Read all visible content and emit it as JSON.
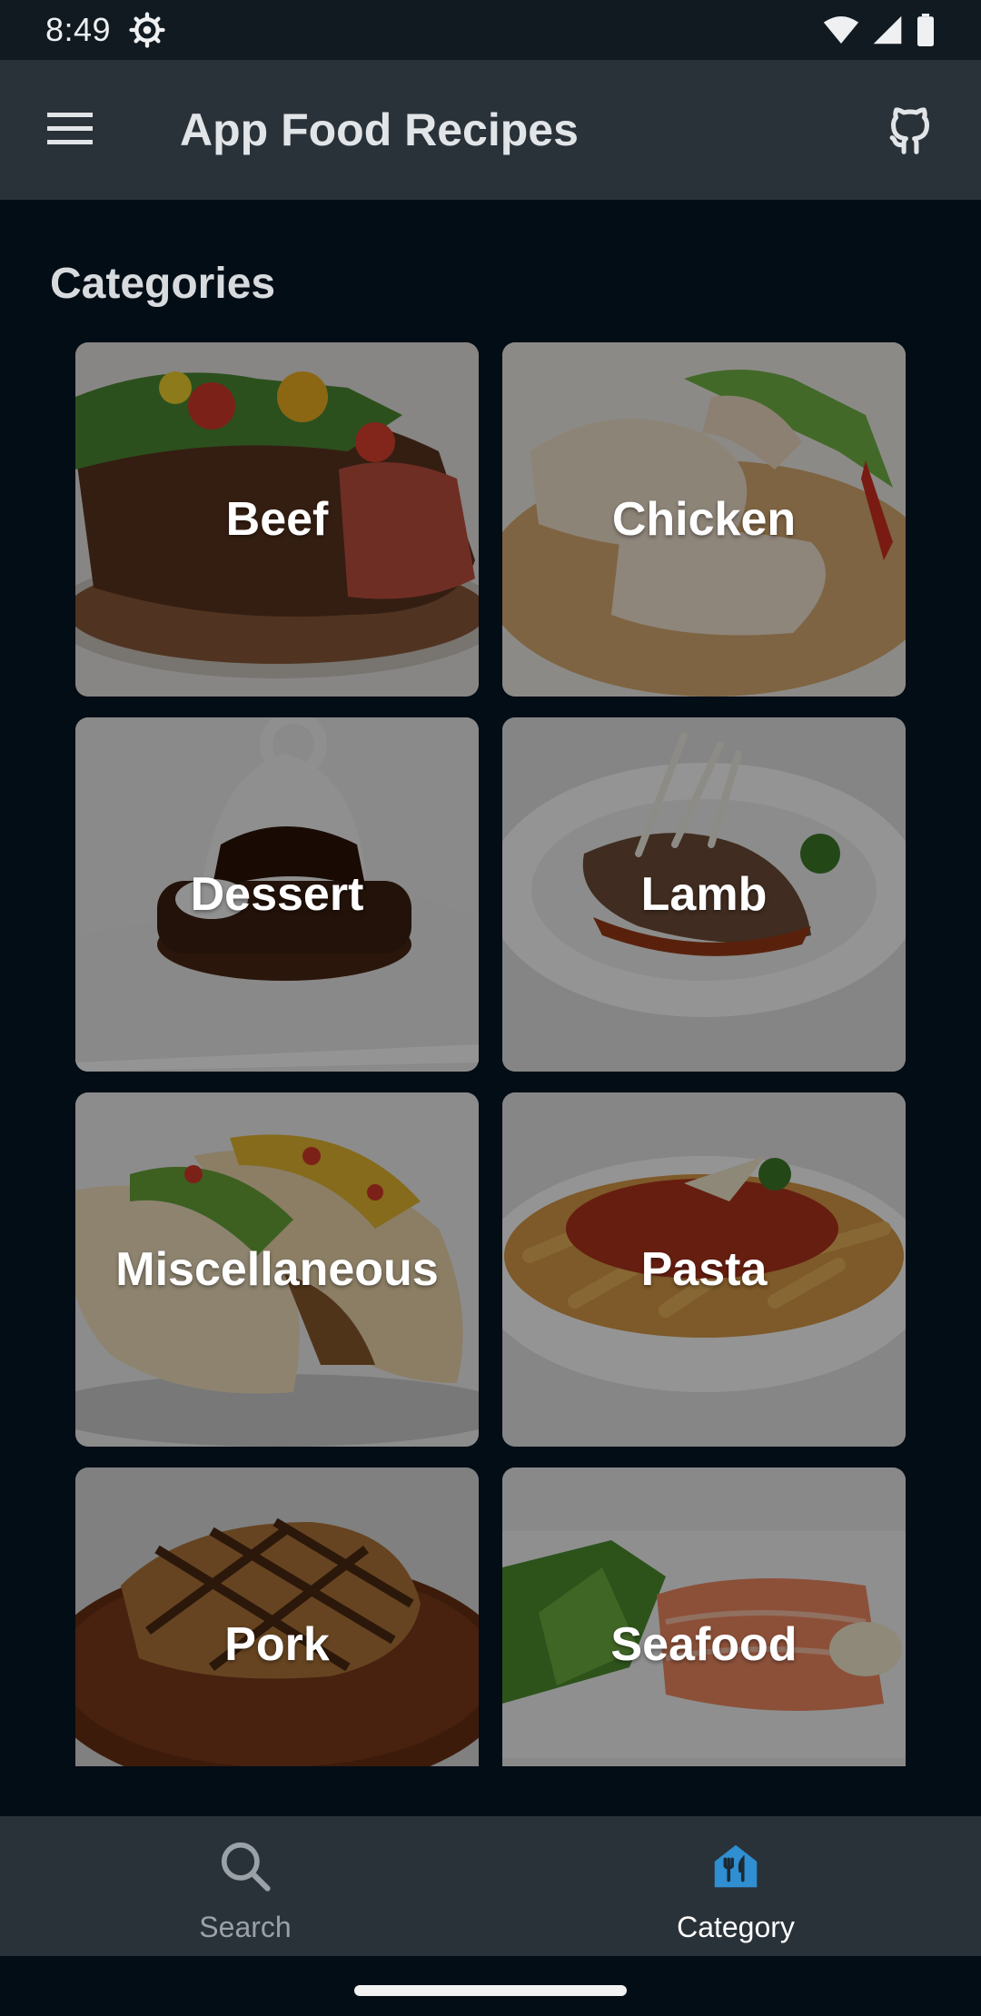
{
  "status_bar": {
    "time": "8:49",
    "icons": [
      "settings-gear-icon",
      "wifi-icon",
      "signal-icon",
      "battery-icon"
    ]
  },
  "app_bar": {
    "title": "App Food Recipes",
    "menu_icon": "hamburger-menu-icon",
    "action_icon": "github-icon"
  },
  "section": {
    "title": "Categories"
  },
  "categories": [
    {
      "label": "Beef"
    },
    {
      "label": "Chicken"
    },
    {
      "label": "Dessert"
    },
    {
      "label": "Lamb"
    },
    {
      "label": "Miscellaneous"
    },
    {
      "label": "Pasta"
    },
    {
      "label": "Pork"
    },
    {
      "label": "Seafood"
    }
  ],
  "bottom_nav": {
    "items": [
      {
        "label": "Search",
        "icon": "search-icon",
        "selected": false
      },
      {
        "label": "Category",
        "icon": "restaurant-icon",
        "selected": true
      }
    ]
  },
  "colors": {
    "background": "#030d16",
    "app_bar": "#2a3239",
    "accent": "#2f8fd1",
    "inactive": "#9aa1a7"
  }
}
